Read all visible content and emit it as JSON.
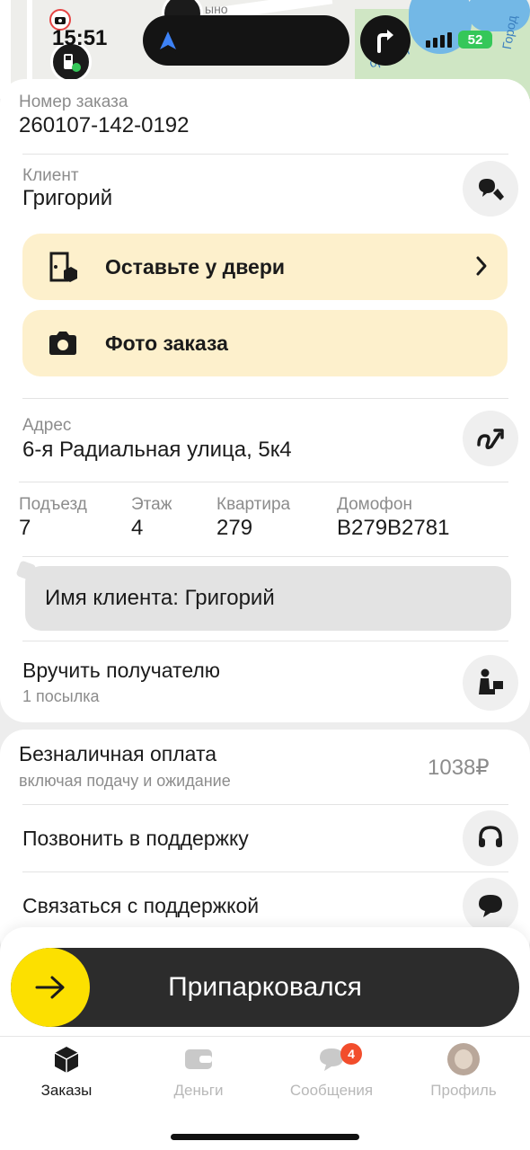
{
  "status_bar": {
    "time": "15:51",
    "battery": "52"
  },
  "map": {
    "labels": [
      "ыно",
      "ородня",
      "Город"
    ]
  },
  "order": {
    "number_label": "Номер заказа",
    "number": "260107-142-0192",
    "client_label": "Клиент",
    "client_name": "Григорий",
    "leave_at_door": "Оставьте у двери",
    "photo_order": "Фото заказа",
    "address_label": "Адрес",
    "address": "6-я Радиальная улица, 5к4",
    "details": [
      {
        "label": "Подъезд",
        "value": "7"
      },
      {
        "label": "Этаж",
        "value": "4"
      },
      {
        "label": "Квартира",
        "value": "279"
      },
      {
        "label": "Домофон",
        "value": "В279В2781"
      }
    ],
    "comment": "Имя клиента: Григорий",
    "handover_title": "Вручить получателю",
    "handover_sub": "1 посылка"
  },
  "payment": {
    "title": "Безналичная оплата",
    "subtitle": "включая подачу и ожидание",
    "amount": "1038₽",
    "call_support": "Позвонить в поддержку",
    "contact_support": "Связаться с поддержкой"
  },
  "slider": {
    "label": "Припарковался"
  },
  "tabs": [
    {
      "label": "Заказы",
      "active": true
    },
    {
      "label": "Деньги",
      "active": false
    },
    {
      "label": "Сообщения",
      "active": false,
      "badge": "4"
    },
    {
      "label": "Профиль",
      "active": false
    }
  ],
  "colors": {
    "accent_yellow": "#fce000",
    "card_yellow": "#fdf0cc",
    "slider_dark": "#2c2c2c",
    "badge_red": "#f24d2c",
    "battery_green": "#35c759"
  }
}
